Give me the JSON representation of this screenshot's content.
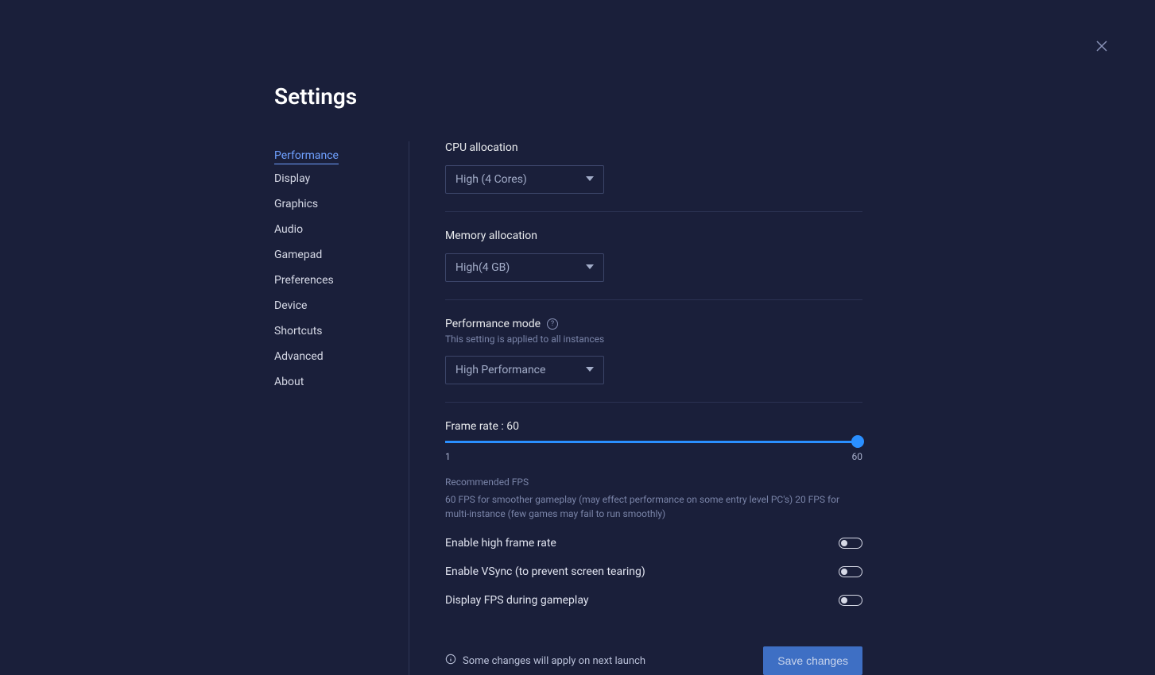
{
  "title": "Settings",
  "close_icon": "close",
  "sidebar": {
    "items": [
      {
        "label": "Performance",
        "active": true
      },
      {
        "label": "Display",
        "active": false
      },
      {
        "label": "Graphics",
        "active": false
      },
      {
        "label": "Audio",
        "active": false
      },
      {
        "label": "Gamepad",
        "active": false
      },
      {
        "label": "Preferences",
        "active": false
      },
      {
        "label": "Device",
        "active": false
      },
      {
        "label": "Shortcuts",
        "active": false
      },
      {
        "label": "Advanced",
        "active": false
      },
      {
        "label": "About",
        "active": false
      }
    ]
  },
  "cpu": {
    "label": "CPU allocation",
    "value": "High (4 Cores)"
  },
  "memory": {
    "label": "Memory allocation",
    "value": "High(4 GB)"
  },
  "perf_mode": {
    "label": "Performance mode",
    "subtext": "This setting is applied to all instances",
    "value": "High Performance"
  },
  "frame_rate": {
    "label": "Frame rate : 60",
    "min": "1",
    "max": "60",
    "value": 60,
    "recommended_title": "Recommended FPS",
    "recommended_body": "60 FPS for smoother gameplay (may effect performance on some entry level PC's) 20 FPS for multi-instance (few games may fail to run smoothly)"
  },
  "toggles": {
    "high_frame_rate": {
      "label": "Enable high frame rate",
      "on": false
    },
    "vsync": {
      "label": "Enable VSync (to prevent screen tearing)",
      "on": false
    },
    "display_fps": {
      "label": "Display FPS during gameplay",
      "on": false
    }
  },
  "footer": {
    "note": "Some changes will apply on next launch",
    "save_label": "Save changes"
  }
}
